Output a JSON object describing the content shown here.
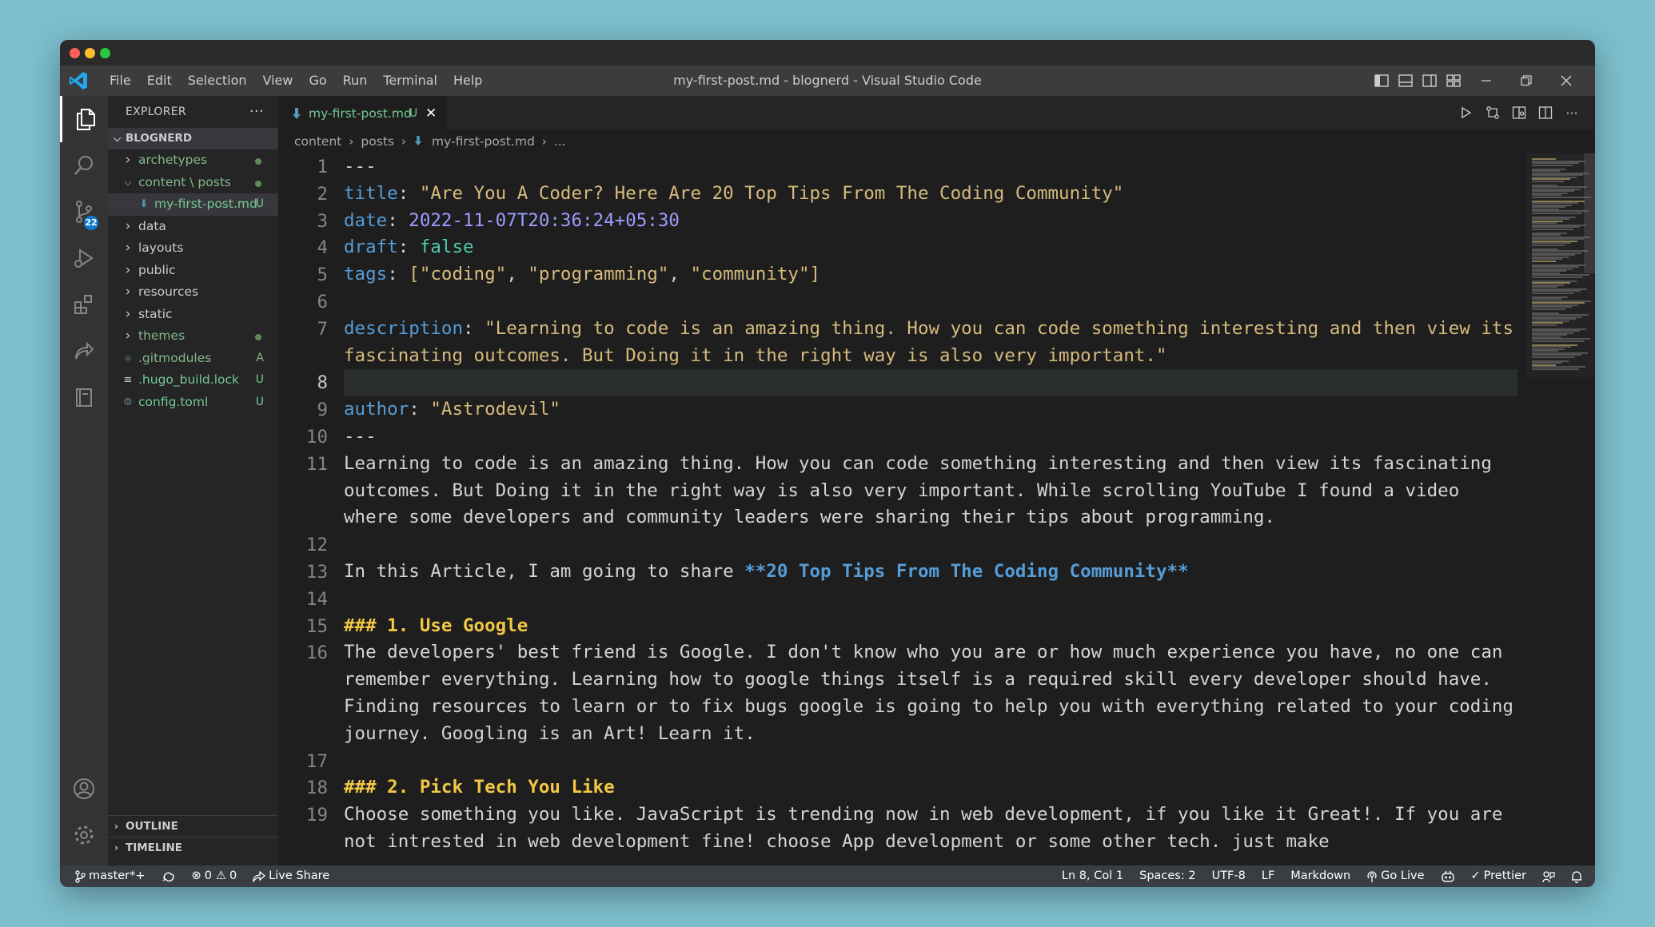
{
  "window": {
    "title": "my-first-post.md - blognerd - Visual Studio Code",
    "colors": {
      "close": "#ff5f57",
      "minimize": "#febc2e",
      "maximize": "#28c840"
    }
  },
  "menu": [
    "File",
    "Edit",
    "Selection",
    "View",
    "Go",
    "Run",
    "Terminal",
    "Help"
  ],
  "activity": {
    "source_control_badge": "22"
  },
  "explorer": {
    "header": "EXPLORER",
    "more": "···",
    "folder": "BLOGNERD",
    "items": [
      {
        "label": "archetypes",
        "mark": "",
        "dot": true,
        "expanded": false,
        "kind": "folder"
      },
      {
        "label": "content \\ posts",
        "mark": "",
        "dot": true,
        "expanded": true,
        "kind": "folder"
      },
      {
        "label": "my-first-post.md",
        "mark": "U",
        "dot": false,
        "kind": "md"
      },
      {
        "label": "data",
        "mark": "",
        "dot": false,
        "expanded": false,
        "kind": "folder"
      },
      {
        "label": "layouts",
        "mark": "",
        "dot": false,
        "expanded": false,
        "kind": "folder"
      },
      {
        "label": "public",
        "mark": "",
        "dot": false,
        "expanded": false,
        "kind": "folder"
      },
      {
        "label": "resources",
        "mark": "",
        "dot": false,
        "expanded": false,
        "kind": "folder"
      },
      {
        "label": "static",
        "mark": "",
        "dot": false,
        "expanded": false,
        "kind": "folder"
      },
      {
        "label": "themes",
        "mark": "",
        "dot": true,
        "expanded": false,
        "kind": "folder"
      },
      {
        "label": ".gitmodules",
        "mark": "A",
        "dot": false,
        "kind": "git"
      },
      {
        "label": ".hugo_build.lock",
        "mark": "U",
        "dot": false,
        "kind": "lock"
      },
      {
        "label": "config.toml",
        "mark": "U",
        "dot": false,
        "kind": "gear"
      }
    ],
    "outline": "OUTLINE",
    "timeline": "TIMELINE"
  },
  "tab": {
    "label": "my-first-post.md",
    "status": "U",
    "close": "✕"
  },
  "breadcrumb": [
    "content",
    "posts",
    "my-first-post.md",
    "..."
  ],
  "editor": {
    "current_line": 8,
    "lines": [
      {
        "n": 1,
        "parts": [
          [
            "---",
            ""
          ]
        ]
      },
      {
        "n": 2,
        "parts": [
          [
            "title",
            "k"
          ],
          [
            ": ",
            ""
          ],
          [
            "\"Are You A Coder? Here Are 20 Top Tips From The Coding Community\"",
            "y"
          ]
        ]
      },
      {
        "n": 3,
        "parts": [
          [
            "date",
            "k"
          ],
          [
            ": ",
            ""
          ],
          [
            "2022-11-07T20:36:24+05:30",
            "v"
          ]
        ]
      },
      {
        "n": 4,
        "parts": [
          [
            "draft",
            "k"
          ],
          [
            ": ",
            ""
          ],
          [
            "false",
            "bool"
          ]
        ]
      },
      {
        "n": 5,
        "parts": [
          [
            "tags",
            "k"
          ],
          [
            ": ",
            ""
          ],
          [
            "[",
            "y"
          ],
          [
            "\"coding\"",
            "y"
          ],
          [
            ", ",
            ""
          ],
          [
            "\"programming\"",
            "y"
          ],
          [
            ", ",
            ""
          ],
          [
            "\"community\"",
            "y"
          ],
          [
            "]",
            "y"
          ]
        ]
      },
      {
        "n": 6,
        "parts": []
      },
      {
        "n": 7,
        "parts": [
          [
            "description",
            "k"
          ],
          [
            ": ",
            ""
          ],
          [
            "\"Learning to code is an amazing thing. How you can code something interesting and then view its fascinating outcomes. But Doing it in the right way is also very important.\"",
            "y"
          ]
        ]
      },
      {
        "n": 8,
        "parts": []
      },
      {
        "n": 9,
        "parts": [
          [
            "author",
            "k"
          ],
          [
            ": ",
            ""
          ],
          [
            "\"Astrodevil\"",
            "y"
          ]
        ]
      },
      {
        "n": 10,
        "parts": [
          [
            "---",
            ""
          ]
        ]
      },
      {
        "n": 11,
        "parts": [
          [
            "Learning to code is an amazing thing. How you can code something interesting and then view its fascinating outcomes. But Doing it in the right way is also very important. While scrolling YouTube I found a video where some developers and community leaders were sharing their tips about programming.",
            ""
          ]
        ]
      },
      {
        "n": 12,
        "parts": []
      },
      {
        "n": 13,
        "parts": [
          [
            "In this Article, I am going to share ",
            ""
          ],
          [
            "**20 Top Tips From The Coding Community**",
            "bd"
          ]
        ]
      },
      {
        "n": 14,
        "parts": []
      },
      {
        "n": 15,
        "parts": [
          [
            "### 1. Use Google",
            "hd"
          ]
        ]
      },
      {
        "n": 16,
        "parts": [
          [
            "The developers' best friend is Google. I don't know who you are or how much experience you have, no one can remember everything. Learning how to google things itself is a required skill every developer should have. Finding resources to learn or to fix bugs google is going to help you with everything related to your coding journey. Googling is an Art! Learn it.",
            ""
          ]
        ]
      },
      {
        "n": 17,
        "parts": []
      },
      {
        "n": 18,
        "parts": [
          [
            "### 2. Pick Tech You Like",
            "hd"
          ]
        ]
      },
      {
        "n": 19,
        "parts": [
          [
            "Choose something you like. JavaScript is trending now in web development, if you like it Great!. If you are not intrested in web development fine! choose App development or some other tech. just make",
            ""
          ]
        ]
      }
    ]
  },
  "status": {
    "branch": "master*+",
    "errors": "0",
    "warnings": "0",
    "live_share": "Live Share",
    "position": "Ln 8, Col 1",
    "spaces": "Spaces: 2",
    "encoding": "UTF-8",
    "eol": "LF",
    "language": "Markdown",
    "go_live": "Go Live",
    "prettier": "Prettier"
  }
}
